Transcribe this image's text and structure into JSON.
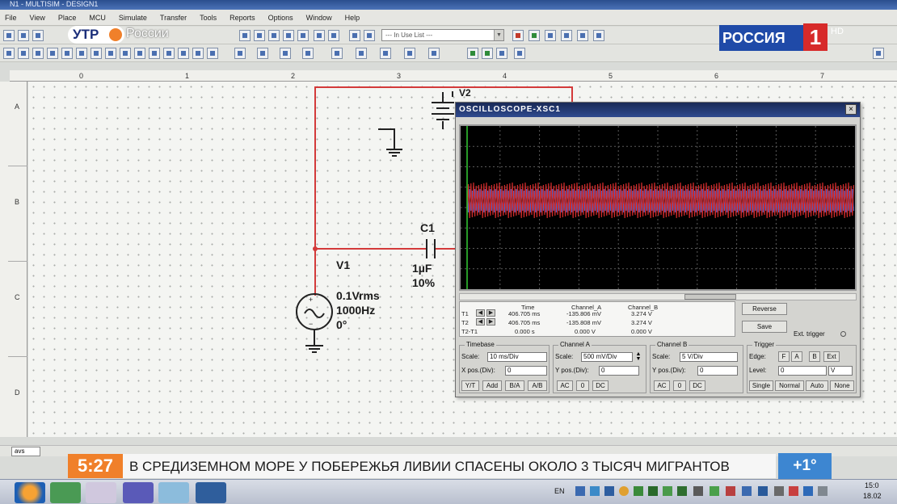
{
  "window": {
    "title": "N1 - MULTISIM - DESIGN1"
  },
  "menubar": [
    "File",
    "View",
    "Place",
    "MCU",
    "Simulate",
    "Transfer",
    "Tools",
    "Reports",
    "Options",
    "Window",
    "Help"
  ],
  "toolbar": {
    "in_use_list": "--- In Use List ---"
  },
  "rulers": {
    "columns": [
      "0",
      "1",
      "2",
      "3",
      "4",
      "5",
      "6",
      "7"
    ],
    "rows": [
      "A",
      "B",
      "C",
      "D"
    ]
  },
  "schematic": {
    "v2_label": "V2",
    "c1": {
      "name": "C1",
      "value": "1µF",
      "tolerance": "10%"
    },
    "v1": {
      "name": "V1",
      "amplitude": "0.1Vrms",
      "frequency": "1000Hz",
      "phase": "0°"
    },
    "wire_color": "#d33a3a"
  },
  "oscilloscope": {
    "title": "OSCILLOSCOPE-XSC1",
    "close": "×",
    "trace_colors": {
      "channel_a": "#cc2a2a",
      "channel_b": "#4a5fc8",
      "grid": "#5a5a5a",
      "background": "#000000"
    },
    "readout": {
      "headers": [
        "Time",
        "Channel_A",
        "Channel_B"
      ],
      "rows": [
        {
          "label": "T1",
          "time": "406.705 ms",
          "a": "-135.806 mV",
          "b": "3.274 V"
        },
        {
          "label": "T2",
          "time": "406.705 ms",
          "a": "-135.808 mV",
          "b": "3.274 V"
        },
        {
          "label": "T2-T1",
          "time": "0.000 s",
          "a": "0.000 V",
          "b": "0.000 V"
        }
      ]
    },
    "buttons": {
      "reverse": "Reverse",
      "save": "Save",
      "ext_trigger": "Ext. trigger"
    },
    "timebase": {
      "title": "Timebase",
      "scale_label": "Scale:",
      "scale": "10 ms/Div",
      "xpos_label": "X pos.(Div):",
      "xpos": "0",
      "modes": [
        "Y/T",
        "Add",
        "B/A",
        "A/B"
      ]
    },
    "channel_a": {
      "title": "Channel A",
      "scale_label": "Scale:",
      "scale": "500 mV/Div",
      "ypos_label": "Y pos.(Div):",
      "ypos": "0",
      "coupling": [
        "AC",
        "0",
        "DC"
      ]
    },
    "channel_b": {
      "title": "Channel B",
      "scale_label": "Scale:",
      "scale": "5 V/Div",
      "ypos_label": "Y pos.(Div):",
      "ypos": "0",
      "coupling": [
        "AC",
        "0",
        "DC"
      ]
    },
    "trigger": {
      "title": "Trigger",
      "edge_label": "Edge:",
      "level_label": "Level:",
      "level": "0",
      "level_unit": "V",
      "modes": [
        "Single",
        "Normal",
        "Auto",
        "None"
      ],
      "edge_buttons": [
        "F",
        "A",
        "B",
        "Ext"
      ]
    }
  },
  "sheet_tab": "avs",
  "broadcast": {
    "utro": "УТР",
    "rossii": "России",
    "channel": "РОССИЯ",
    "channel_number": "1",
    "hd": "HD",
    "time": "5:27",
    "ticker": "В СРЕДИЗЕМНОМ МОРЕ У ПОБЕРЕЖЬЯ ЛИВИИ СПАСЕНЫ ОКОЛО 3 ТЫСЯЧ МИГРАНТОВ",
    "temperature": "+1°"
  },
  "taskbar": {
    "lang": "EN",
    "clock_time": "15:0",
    "clock_date": "18.02"
  }
}
